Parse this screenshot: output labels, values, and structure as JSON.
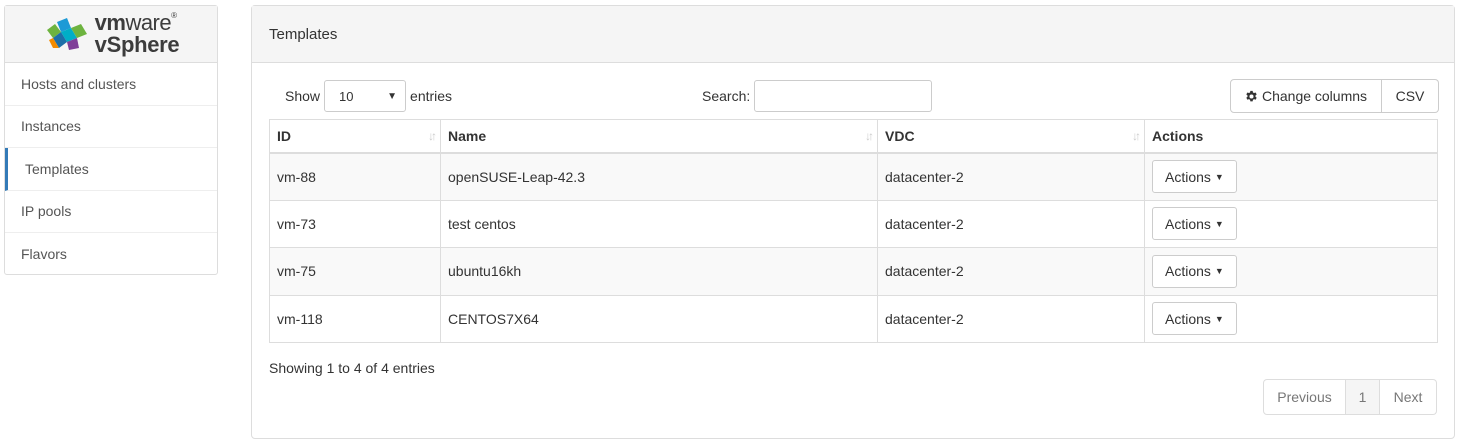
{
  "logo": {
    "brand_bold": "vm",
    "brand_thin": "ware",
    "product": "vSphere",
    "colors": [
      "#6db33f",
      "#1d9ad6",
      "#00aec7",
      "#f38b00",
      "#7f3f98"
    ]
  },
  "sidebar": {
    "items": [
      {
        "label": "Hosts and clusters"
      },
      {
        "label": "Instances"
      },
      {
        "label": "Templates",
        "active": true
      },
      {
        "label": "IP pools"
      },
      {
        "label": "Flavors"
      }
    ]
  },
  "panel": {
    "title": "Templates"
  },
  "toolbar": {
    "show_label": "Show",
    "entries_value": "10",
    "entries_label": "entries",
    "search_label": "Search:",
    "search_value": "",
    "change_columns_label": "Change columns",
    "change_columns_icon": "gear-icon",
    "csv_label": "CSV"
  },
  "table": {
    "columns": [
      "ID",
      "Name",
      "VDC",
      "Actions"
    ],
    "rows": [
      {
        "id": "vm-88",
        "name": "openSUSE-Leap-42.3",
        "vdc": "datacenter-2",
        "action": "Actions"
      },
      {
        "id": "vm-73",
        "name": "test centos",
        "vdc": "datacenter-2",
        "action": "Actions"
      },
      {
        "id": "vm-75",
        "name": "ubuntu16kh",
        "vdc": "datacenter-2",
        "action": "Actions"
      },
      {
        "id": "vm-118",
        "name": "CENTOS7X64",
        "vdc": "datacenter-2",
        "action": "Actions"
      }
    ]
  },
  "footer": {
    "info": "Showing 1 to 4 of 4 entries",
    "prev_label": "Previous",
    "page_label": "1",
    "next_label": "Next"
  },
  "colors": {
    "accent": "#337ab7",
    "border": "#dddddd",
    "header_bg": "#f5f5f5",
    "stripe": "#f9f9f9"
  }
}
